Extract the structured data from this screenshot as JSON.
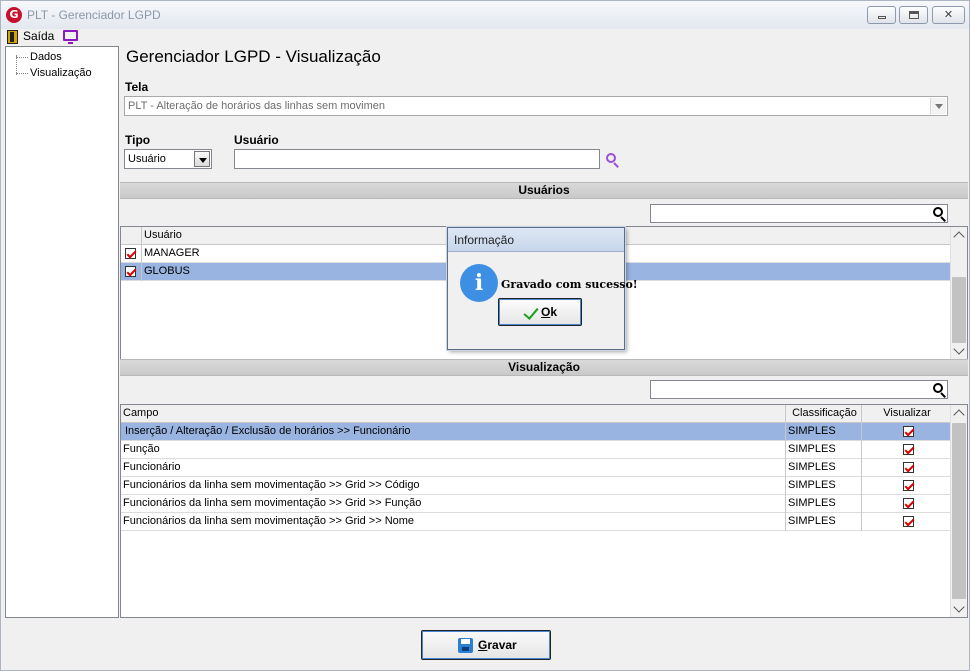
{
  "window": {
    "title": "PLT - Gerenciador LGPD",
    "logo_letter": "G"
  },
  "window_controls": {
    "minimize": "",
    "maximize": "",
    "close": "✕"
  },
  "toolbar": {
    "exit_label": "Saída"
  },
  "tree": {
    "items": [
      {
        "label": "Dados"
      },
      {
        "label": "Visualização"
      }
    ]
  },
  "page": {
    "title": "Gerenciador LGPD - Visualização"
  },
  "form": {
    "tela": {
      "label": "Tela",
      "value": "PLT - Alteração de horários das linhas sem movimen"
    },
    "tipo": {
      "label": "Tipo",
      "value": "Usuário"
    },
    "usuario": {
      "label": "Usuário",
      "value": ""
    }
  },
  "users_section": {
    "title": "Usuários",
    "search_value": "",
    "column": "Usuário",
    "rows": [
      {
        "name": "MANAGER",
        "checked": true,
        "selected": false
      },
      {
        "name": "GLOBUS",
        "checked": true,
        "selected": true
      }
    ]
  },
  "visual_section": {
    "title": "Visualização",
    "search_value": "",
    "columns": {
      "campo": "Campo",
      "classificacao": "Classificação",
      "visualizar": "Visualizar"
    },
    "rows": [
      {
        "campo": "Inserção / Alteração / Exclusão de horários >> Funcionário",
        "classificacao": "SIMPLES",
        "visualizar": true,
        "selected": true
      },
      {
        "campo": "Função",
        "classificacao": "SIMPLES",
        "visualizar": true,
        "selected": false
      },
      {
        "campo": "Funcionário",
        "classificacao": "SIMPLES",
        "visualizar": true,
        "selected": false
      },
      {
        "campo": "Funcionários da linha sem movimentação >> Grid >> Código",
        "classificacao": "SIMPLES",
        "visualizar": true,
        "selected": false
      },
      {
        "campo": "Funcionários da linha sem movimentação >> Grid >> Função",
        "classificacao": "SIMPLES",
        "visualizar": true,
        "selected": false
      },
      {
        "campo": "Funcionários da linha sem movimentação >> Grid >> Nome",
        "classificacao": "SIMPLES",
        "visualizar": true,
        "selected": false
      }
    ]
  },
  "actions": {
    "save_label": "Gravar"
  },
  "dialog": {
    "title": "Informação",
    "icon": "i",
    "message": "Gravado com sucesso!",
    "ok_label": "Ok"
  }
}
